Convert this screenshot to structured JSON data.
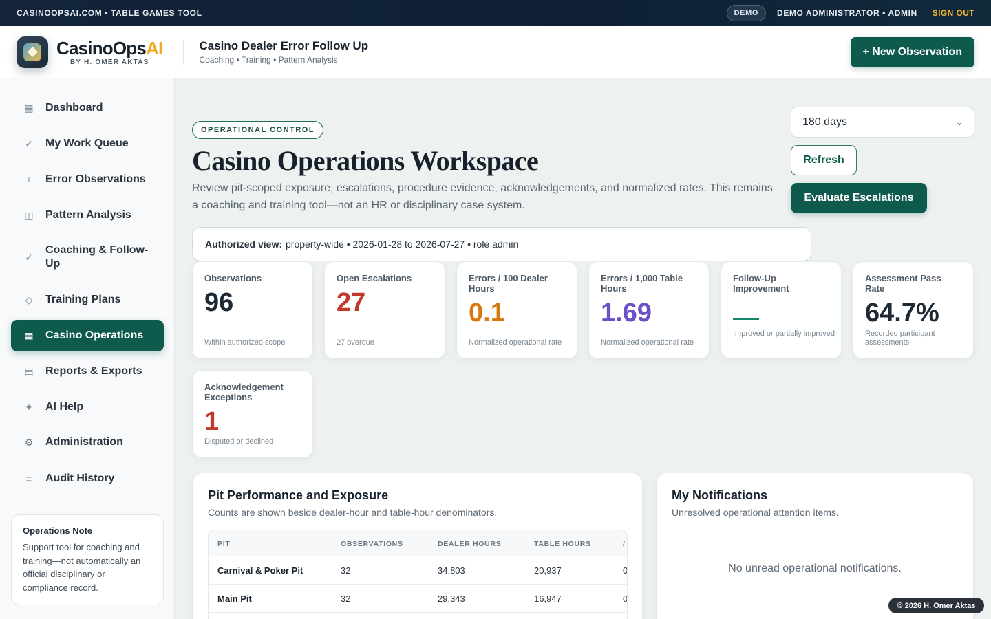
{
  "topbar": {
    "brand_line": "CASINOOPSAI.COM • TABLE GAMES TOOL",
    "mode_badge": "DEMO",
    "user": "DEMO ADMINISTRATOR • ADMIN",
    "sign_out": "SIGN OUT"
  },
  "header": {
    "brand_name": "CasinoOps",
    "brand_name_accent": "AI",
    "brand_byline": "BY H. OMER AKTAS",
    "app_title": "Casino Dealer Error Follow Up",
    "app_crumbs": "Coaching • Training • Pattern Analysis",
    "new_observation": "+ New Observation"
  },
  "sidebar": {
    "items": [
      {
        "label": "Dashboard",
        "icon": "grid-icon",
        "glyph": "▦"
      },
      {
        "label": "My Work Queue",
        "icon": "check-icon",
        "glyph": "✓"
      },
      {
        "label": "Error Observations",
        "icon": "plus-icon",
        "glyph": "+"
      },
      {
        "label": "Pattern Analysis",
        "icon": "columns-icon",
        "glyph": "◫"
      },
      {
        "label": "Coaching & Follow-Up",
        "icon": "check-icon",
        "glyph": "✓"
      },
      {
        "label": "Training Plans",
        "icon": "diamond-icon",
        "glyph": "◇"
      },
      {
        "label": "Casino Operations",
        "icon": "building-icon",
        "glyph": "▦"
      },
      {
        "label": "Reports & Exports",
        "icon": "report-icon",
        "glyph": "▤"
      },
      {
        "label": "AI Help",
        "icon": "sparkle-icon",
        "glyph": "✦"
      },
      {
        "label": "Administration",
        "icon": "gear-icon",
        "glyph": "⚙"
      },
      {
        "label": "Audit History",
        "icon": "list-icon",
        "glyph": "≡"
      }
    ],
    "active_item": "Casino Operations",
    "note": {
      "title": "Operations Note",
      "body": "Support tool for coaching and training—not automatically an official disciplinary or compliance record."
    }
  },
  "main": {
    "eyebrow": "OPERATIONAL CONTROL",
    "title": "Casino Operations Workspace",
    "description": "Review pit-scoped exposure, escalations, procedure evidence, acknowledgements, and normalized rates. This remains a coaching and training tool—not an HR or disciplinary case system.",
    "period_select": {
      "selected": "180 days"
    },
    "refresh": "Refresh",
    "evaluate": "Evaluate Escalations",
    "auth": {
      "label": "Authorized view:",
      "text": "property-wide • 2026-01-28 to 2026-07-27 • role admin"
    }
  },
  "kpis": [
    {
      "label": "Observations",
      "value": "96",
      "sub": "Within authorized scope",
      "color": "#1f2933"
    },
    {
      "label": "Open Escalations",
      "value": "27",
      "sub": "27 overdue",
      "color": "#c0392b"
    },
    {
      "label": "Errors / 100 Dealer Hours",
      "value": "0.1",
      "sub": "Normalized operational rate",
      "color": "#d9780f"
    },
    {
      "label": "Errors / 1,000 Table Hours",
      "value": "1.69",
      "sub": "Normalized operational rate",
      "color": "#6a4fc6"
    },
    {
      "label": "Follow-Up Improvement",
      "value": "—",
      "sub": "Improved or partially improved",
      "color": "#16866a"
    },
    {
      "label": "Assessment Pass Rate",
      "value": "64.7%",
      "sub": "Recorded participant assessments",
      "color": "#1f2933"
    },
    {
      "label": "Acknowledgement Exceptions",
      "value": "1",
      "sub": "Disputed or declined",
      "color": "#c0392b"
    }
  ],
  "pit_panel": {
    "title": "Pit Performance and Exposure",
    "subtitle": "Counts are shown beside dealer-hour and table-hour denominators.",
    "columns": [
      "PIT",
      "OBSERVATIONS",
      "DEALER HOURS",
      "TABLE HOURS",
      "/"
    ],
    "rows": [
      {
        "pit": "Carnival & Poker Pit",
        "observations": "32",
        "dealer_hours": "34,803",
        "table_hours": "20,937",
        "rate": "0"
      },
      {
        "pit": "Main Pit",
        "observations": "32",
        "dealer_hours": "29,343",
        "table_hours": "16,947",
        "rate": "0"
      }
    ]
  },
  "notifications": {
    "title": "My Notifications",
    "subtitle": "Unresolved operational attention items.",
    "empty": "No unread operational notifications."
  },
  "footer": {
    "copyright": "© 2026 H. Omer Aktas"
  }
}
